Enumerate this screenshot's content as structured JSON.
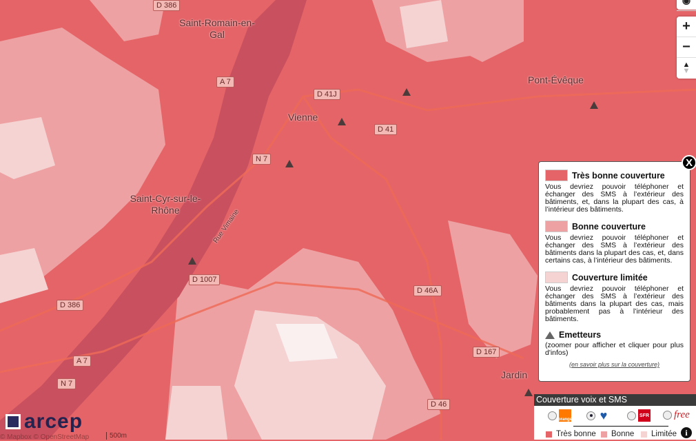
{
  "map": {
    "places": [
      "Saint-Romain-en-Gal",
      "Vienne",
      "Pont-Évêque",
      "Saint-Cyr-sur-le-Rhône",
      "Jardin"
    ],
    "roads": [
      "D 386",
      "A 7",
      "D 41J",
      "D 41",
      "N 7",
      "D 1007",
      "D 386",
      "A 7",
      "N 7",
      "D 46A",
      "D 167",
      "D 46"
    ],
    "street": "Rue Vimaine",
    "scale": "500m",
    "attribution": "© Mapbox © OpenStreetMap",
    "colors": {
      "tres_bonne": "#e46468",
      "bonne": "#eea1a2",
      "limitee": "#f6d3d3",
      "river": "#c9505f"
    }
  },
  "controls": {
    "zoom_in": "+",
    "zoom_out": "−"
  },
  "brand": {
    "logo_text": "arcep"
  },
  "legend": {
    "close": "X",
    "items": [
      {
        "title": "Très bonne couverture",
        "text": "Vous devriez pouvoir téléphoner et échanger des SMS à l’extérieur des bâtiments, et, dans la plupart des cas, à l’intérieur des bâtiments.",
        "color": "#e46468"
      },
      {
        "title": "Bonne couverture",
        "text": "Vous devriez pouvoir téléphoner et échanger des SMS à l’extérieur des bâtiments dans la plupart des cas, et, dans certains cas, à l’intérieur des bâtiments.",
        "color": "#eea1a2"
      },
      {
        "title": "Couverture limitée",
        "text": "Vous devriez pouvoir téléphoner et échanger des SMS à l’extérieur des bâtiments dans la plupart des cas, mais probablement pas à l’intérieur des bâtiments.",
        "color": "#f6d3d3"
      }
    ],
    "emitters_title": "Emetteurs",
    "emitters_text": "(zoomer pour afficher et cliquer pour plus d'infos)",
    "more_link": "(en savoir plus sur la couverture)"
  },
  "panel": {
    "title": "Couverture voix et SMS",
    "operators": [
      {
        "name": "orange",
        "selected": false
      },
      {
        "name": "bouygues",
        "selected": true
      },
      {
        "name": "SFR",
        "selected": false
      },
      {
        "name": "free",
        "selected": false
      }
    ],
    "legend": [
      "Très bonne",
      "Bonne",
      "Limitée"
    ],
    "info": "i"
  }
}
